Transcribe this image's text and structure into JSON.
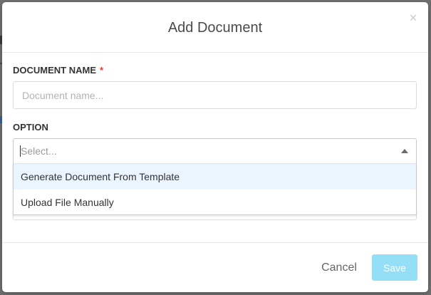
{
  "modal": {
    "title": "Add Document",
    "close_glyph": "×"
  },
  "document_name": {
    "label": "DOCUMENT NAME",
    "required_mark": "*",
    "placeholder": "Document name...",
    "value": ""
  },
  "option": {
    "label": "OPTION",
    "placeholder": "Select...",
    "dropdown_open": true,
    "options": [
      {
        "label": "Generate Document From Template",
        "highlighted": true
      },
      {
        "label": "Upload File Manually",
        "highlighted": false
      }
    ]
  },
  "footer": {
    "cancel_label": "Cancel",
    "save_label": "Save"
  },
  "colors": {
    "required": "#e53935",
    "save_button_disabled": "#94dff5",
    "option_highlight": "#ebf5ff"
  },
  "icons": {
    "close": "close-icon",
    "dropdown_arrow": "chevron-up-icon"
  }
}
